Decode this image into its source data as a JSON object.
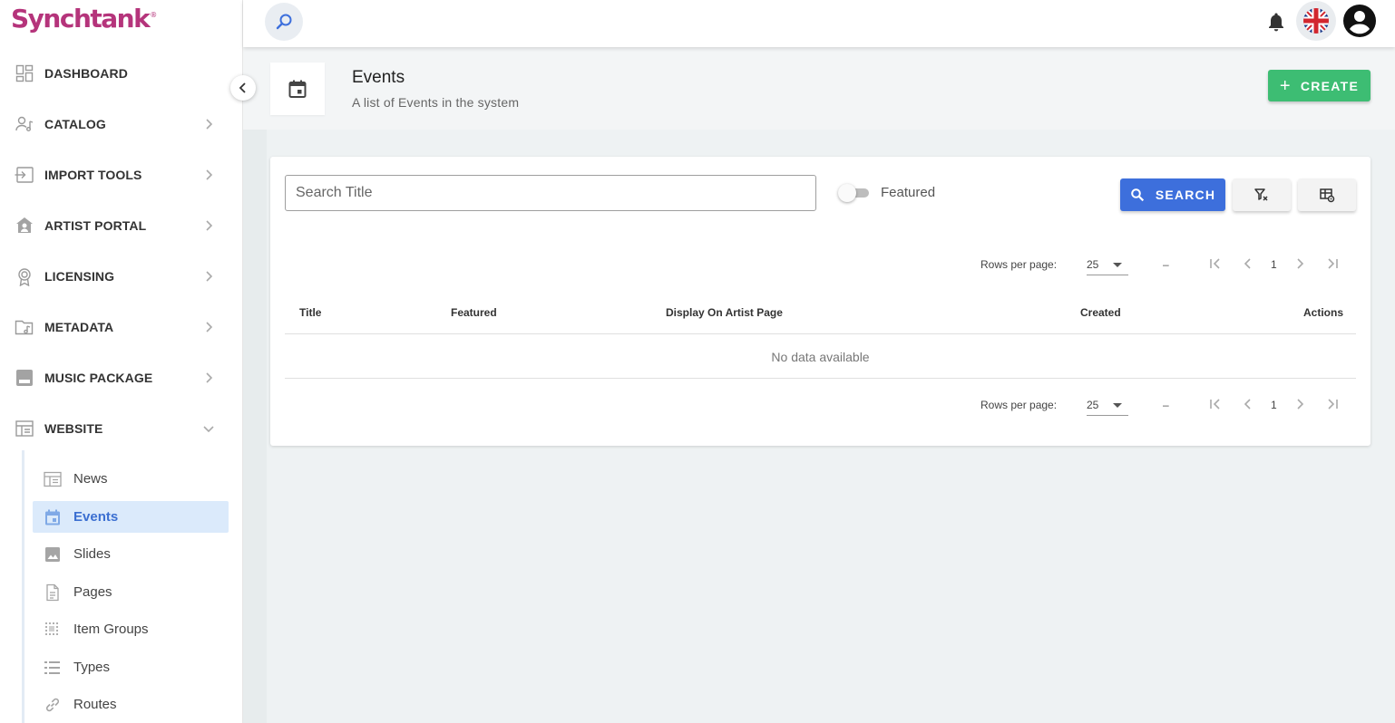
{
  "app": {
    "logo": "Synchtank",
    "logo_mark": "®"
  },
  "sidebar": {
    "items": [
      {
        "label": "DASHBOARD",
        "icon": "dashboard-icon"
      },
      {
        "label": "CATALOG",
        "icon": "catalog-icon"
      },
      {
        "label": "IMPORT TOOLS",
        "icon": "import-icon"
      },
      {
        "label": "ARTIST PORTAL",
        "icon": "artist-portal-icon"
      },
      {
        "label": "LICENSING",
        "icon": "licensing-icon"
      },
      {
        "label": "METADATA",
        "icon": "metadata-icon"
      },
      {
        "label": "MUSIC PACKAGE",
        "icon": "music-package-icon"
      },
      {
        "label": "WEBSITE",
        "icon": "website-icon"
      }
    ],
    "website_sub": [
      {
        "label": "News",
        "icon": "news-icon"
      },
      {
        "label": "Events",
        "icon": "calendar-icon",
        "active": true
      },
      {
        "label": "Slides",
        "icon": "image-icon"
      },
      {
        "label": "Pages",
        "icon": "page-icon"
      },
      {
        "label": "Item Groups",
        "icon": "item-groups-icon"
      },
      {
        "label": "Types",
        "icon": "list-icon"
      },
      {
        "label": "Routes",
        "icon": "link-icon"
      }
    ]
  },
  "header": {
    "title": "Events",
    "subtitle": "A list of Events in the system",
    "create_label": "CREATE"
  },
  "filters": {
    "search_placeholder": "Search Title",
    "search_value": "",
    "featured_label": "Featured",
    "featured_on": false,
    "search_button": "SEARCH"
  },
  "pagination": {
    "rows_per_page_label": "Rows per page:",
    "rows_per_page": "25",
    "range": "–",
    "page": "1"
  },
  "table": {
    "columns": [
      "Title",
      "Featured",
      "Display On Artist Page",
      "Created",
      "Actions"
    ],
    "rows": [],
    "empty_text": "No data available"
  },
  "colors": {
    "brand": "#b5347b",
    "primary": "#3d6fdc",
    "success": "#3dbd73",
    "active_bg": "#dbeafb"
  }
}
